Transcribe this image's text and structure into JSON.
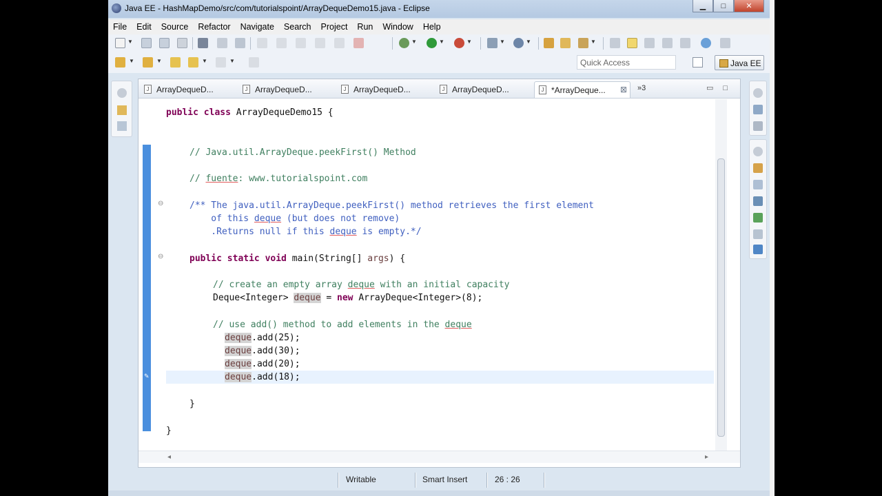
{
  "window": {
    "title": "Java EE - HashMapDemo/src/com/tutorialspoint/ArrayDequeDemo15.java - Eclipse"
  },
  "menu": [
    "File",
    "Edit",
    "Source",
    "Refactor",
    "Navigate",
    "Search",
    "Project",
    "Run",
    "Window",
    "Help"
  ],
  "toolbar": {
    "quick_access_placeholder": "Quick Access",
    "perspective_label": "Java EE"
  },
  "tabs": [
    {
      "label": "ArrayDequeD...",
      "active": false
    },
    {
      "label": "ArrayDequeD...",
      "active": false
    },
    {
      "label": "ArrayDequeD...",
      "active": false
    },
    {
      "label": "ArrayDequeD...",
      "active": false
    },
    {
      "label": "*ArrayDeque...",
      "active": true
    }
  ],
  "tab_overflow": "»3",
  "code": {
    "l1_a": "public class",
    "l1_b": " ArrayDequeDemo15 {",
    "l2": "// Java.util.ArrayDeque.peekFirst() Method",
    "l3_a": "// ",
    "l3_b": "fuente",
    "l3_c": ": www.tutorialspoint.com",
    "l4_a": "/** The java.util.ArrayDeque.peekFirst() method retrieves the first element",
    "l4_b1": "    of this ",
    "l4_b2": "deque",
    "l4_b3": " (but does not remove)",
    "l4_c1": "    .Returns null if this ",
    "l4_c2": "deque",
    "l4_c3": " is empty.*/",
    "l5_a": "public static void",
    "l5_b": " main(String[] ",
    "l5_c": "args",
    "l5_d": ") {",
    "l6_a": "// create an empty array ",
    "l6_b": "deque",
    "l6_c": " with an initial capacity",
    "l7_a": "Deque<Integer> ",
    "l7_b": "deque",
    "l7_c": " = ",
    "l7_d": "new",
    "l7_e": " ArrayDeque<Integer>(8);",
    "l8_a": "// use add() method to add elements in the ",
    "l8_b": "deque",
    "add_var": "deque",
    "add_1": ".add(25);",
    "add_2": ".add(30);",
    "add_3": ".add(20);",
    "add_4": ".add(18);",
    "close_method": "}",
    "close_class": "}"
  },
  "status": {
    "writable": "Writable",
    "insert_mode": "Smart Insert",
    "position": "26 : 26"
  }
}
